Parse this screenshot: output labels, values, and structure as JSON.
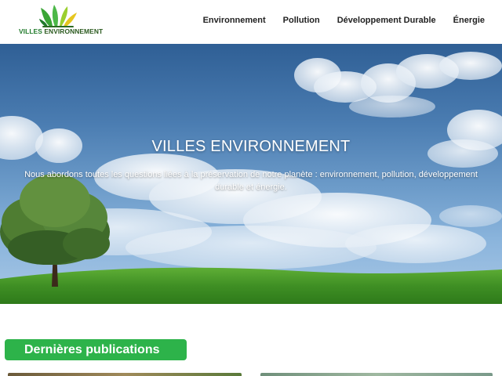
{
  "header": {
    "logo": {
      "text_part1": "VILLES",
      "text_part2": "ENVIRONNEMENT"
    },
    "nav": [
      {
        "label": "Environnement"
      },
      {
        "label": "Pollution"
      },
      {
        "label": "Développement Durable"
      },
      {
        "label": "Énergie"
      }
    ]
  },
  "hero": {
    "title": "VILLES ENVIRONNEMENT",
    "subtitle": "Nous abordons toutes les questions liées à la préservation de notre planète : environnement, pollution, développement durable et énergie."
  },
  "section": {
    "title": "Dernières publications"
  },
  "colors": {
    "brand_green": "#2db34a",
    "logo_green": "#1f7a2a",
    "nav_text": "#222222",
    "sky_top": "#2f5f95",
    "grass": "#4e9a2e"
  },
  "icons": {
    "logo": "leaf-sprouts-logo-icon"
  }
}
